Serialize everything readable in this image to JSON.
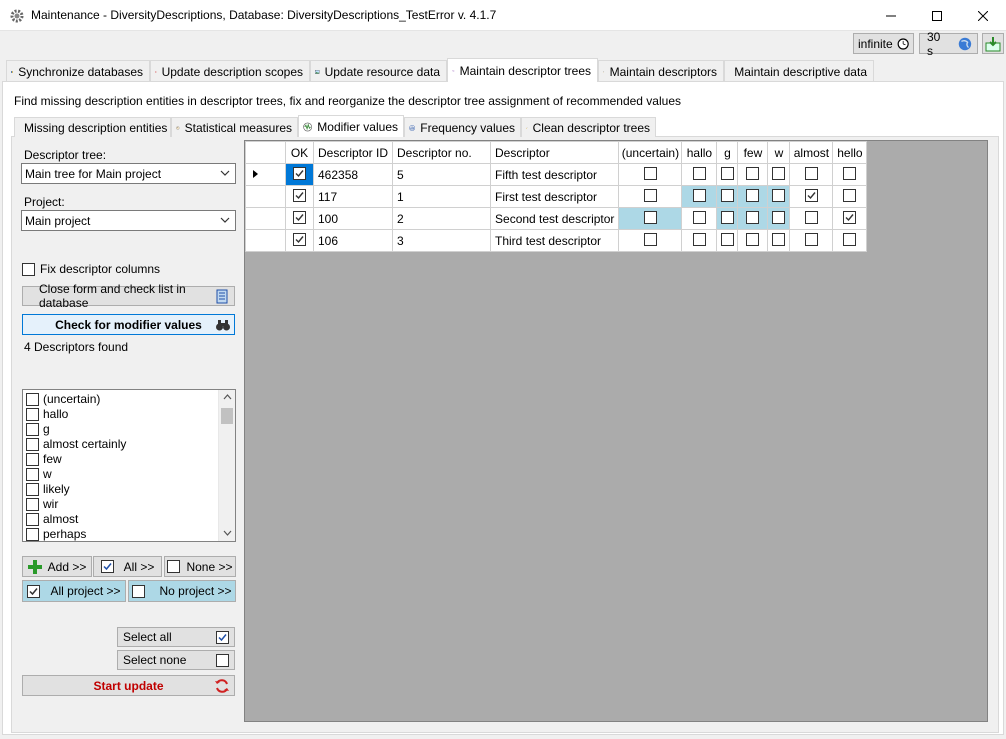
{
  "window": {
    "title": "Maintenance - DiversityDescriptions,  Database: DiversityDescriptions_TestError    v. 4.1.7"
  },
  "toolbar": {
    "timeout_label": "infinite",
    "interval_label": "30 s"
  },
  "main_tabs": [
    {
      "label": "Synchronize databases",
      "icon": "sync-icon"
    },
    {
      "label": "Update description scopes",
      "icon": "target-icon"
    },
    {
      "label": "Update resource data",
      "icon": "image-icon"
    },
    {
      "label": "Maintain descriptor trees",
      "icon": "tree-icon",
      "active": true
    },
    {
      "label": "Maintain descriptors",
      "icon": "descriptor-icon"
    },
    {
      "label": "Maintain descriptive data",
      "icon": "data-icon"
    }
  ],
  "info_text": "Find missing description entities in descriptor trees, fix and reorganize the descriptor tree assignment of recommended values",
  "sub_tabs": [
    {
      "label": "Missing description entities",
      "icon": "missing-icon"
    },
    {
      "label": "Statistical measures",
      "icon": "gauge-icon"
    },
    {
      "label": "Modifier values",
      "icon": "modifier-icon",
      "active": true
    },
    {
      "label": "Frequency values",
      "icon": "frequency-icon"
    },
    {
      "label": "Clean descriptor trees",
      "icon": "broom-icon"
    }
  ],
  "left": {
    "descriptor_tree_label": "Descriptor tree:",
    "descriptor_tree_value": "Main tree for Main project",
    "project_label": "Project:",
    "project_value": "Main project",
    "fix_columns_label": "Fix descriptor columns",
    "fix_columns_checked": false,
    "close_form_label": "Close form and check list in database",
    "check_modifier_label": "Check for modifier values",
    "found_text": "4 Descriptors found",
    "modifiers": [
      {
        "label": "(uncertain)",
        "checked": false
      },
      {
        "label": "hallo",
        "checked": false
      },
      {
        "label": "g",
        "checked": false
      },
      {
        "label": "almost certainly",
        "checked": false
      },
      {
        "label": "few",
        "checked": false
      },
      {
        "label": "w",
        "checked": false
      },
      {
        "label": "likely",
        "checked": false
      },
      {
        "label": "wir",
        "checked": false
      },
      {
        "label": "almost",
        "checked": false
      },
      {
        "label": "perhaps",
        "checked": false
      }
    ],
    "add_label": "Add >>",
    "all_label": "All >>",
    "none_label": "None >>",
    "all_project_label": "All project >>",
    "no_project_label": "No project >>",
    "select_all_label": "Select all",
    "select_none_label": "Select none",
    "start_update_label": "Start update"
  },
  "grid": {
    "columns": [
      "OK",
      "Descriptor ID",
      "Descriptor no.",
      "Descriptor",
      "(uncertain)",
      "hallo",
      "g",
      "few",
      "w",
      "almost",
      "hello"
    ],
    "rows": [
      {
        "ok": true,
        "id": "462358",
        "no": "5",
        "descriptor": "Fifth test descriptor",
        "flags": [
          false,
          false,
          false,
          false,
          false,
          false,
          false
        ],
        "hl": [
          false,
          false,
          false,
          false,
          false,
          false,
          false
        ],
        "current": true
      },
      {
        "ok": true,
        "id": "117",
        "no": "1",
        "descriptor": "First test descriptor",
        "flags": [
          false,
          false,
          false,
          false,
          false,
          true,
          false
        ],
        "hl": [
          false,
          true,
          true,
          true,
          true,
          false,
          false
        ],
        "current": false
      },
      {
        "ok": true,
        "id": "100",
        "no": "2",
        "descriptor": "Second test descriptor",
        "flags": [
          false,
          false,
          false,
          false,
          false,
          false,
          true
        ],
        "hl": [
          true,
          false,
          true,
          true,
          true,
          false,
          false
        ],
        "current": false
      },
      {
        "ok": true,
        "id": "106",
        "no": "3",
        "descriptor": "Third test descriptor",
        "flags": [
          false,
          false,
          false,
          false,
          false,
          false,
          false
        ],
        "hl": [
          false,
          false,
          false,
          false,
          false,
          false,
          false
        ],
        "current": false
      }
    ]
  },
  "colors": {
    "highlight": "#add8e6",
    "grid_background": "#ababab",
    "start_update_text": "#c00000"
  }
}
